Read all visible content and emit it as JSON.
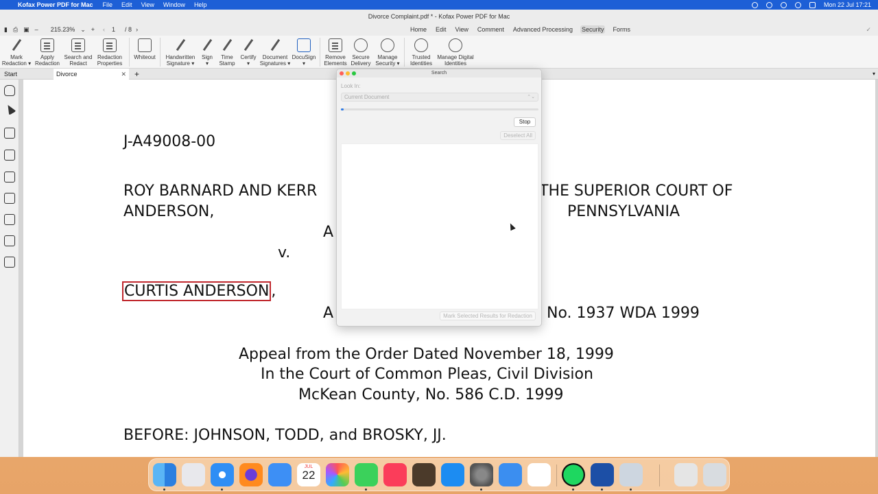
{
  "menubar": {
    "app_name": "Kofax Power PDF for Mac",
    "items": [
      "File",
      "Edit",
      "View",
      "Window",
      "Help"
    ],
    "datetime": "Mon 22 Jul  17:21"
  },
  "window": {
    "title": "Divorce Complaint.pdf * - Kofax Power PDF for Mac",
    "zoom": "215.23%",
    "page_current": "1",
    "page_total": "/ 8",
    "nav_tabs": [
      "Home",
      "Edit",
      "View",
      "Comment",
      "Advanced Processing",
      "Security",
      "Forms"
    ],
    "active_tab": "Security"
  },
  "ribbon": {
    "tools": [
      {
        "line1": "Mark",
        "line2": "Redaction ▾"
      },
      {
        "line1": "Apply",
        "line2": "Redaction"
      },
      {
        "line1": "Search and",
        "line2": "Redact"
      },
      {
        "line1": "Redaction",
        "line2": "Properties"
      },
      {
        "line1": "Whiteout",
        "line2": ""
      },
      {
        "line1": "Handwritten",
        "line2": "Signature ▾"
      },
      {
        "line1": "Sign",
        "line2": "▾"
      },
      {
        "line1": "Time",
        "line2": "Stamp"
      },
      {
        "line1": "Certify",
        "line2": "▾"
      },
      {
        "line1": "Document",
        "line2": "Signatures ▾"
      },
      {
        "line1": "DocuSign",
        "line2": "▾"
      },
      {
        "line1": "Remove",
        "line2": "Elements"
      },
      {
        "line1": "Secure",
        "line2": "Delivery"
      },
      {
        "line1": "Manage",
        "line2": "Security ▾"
      },
      {
        "line1": "Trusted",
        "line2": "Identities"
      },
      {
        "line1": "Manage Digital",
        "line2": "Identities"
      }
    ]
  },
  "tabs": {
    "start": "Start",
    "document": "Divorce Complaint.pdf *"
  },
  "document": {
    "case_id": "J-A49008-00",
    "plaintiff_line1": "ROY BARNARD AND KERR",
    "plaintiff_line2": "ANDERSON,",
    "court_line1": "THE SUPERIOR COURT OF",
    "court_line2": "PENNSYLVANIA",
    "fragment_a1": "A",
    "versus": "v.",
    "defendant": "CURTIS ANDERSON",
    "defendant_comma": ",",
    "fragment_a2": "A",
    "docket": "No. 1937 WDA 1999",
    "appeal_line1": "Appeal from the Order Dated November 18, 1999",
    "appeal_line2": "In the Court of Common Pleas, Civil Division",
    "appeal_line3": "McKean County, No. 586 C.D. 1999",
    "before": "BEFORE:  JOHNSON, TODD, and BROSKY, JJ."
  },
  "search_panel": {
    "title": "Search",
    "look_in_label": "Look In:",
    "look_in_value": "Current Document",
    "progress_fraction": 0.01,
    "stop_label": "Stop",
    "deselect_label": "Deselect All",
    "mark_label": "Mark Selected Results for Redaction"
  },
  "dock": {
    "calendar_month": "JUL",
    "calendar_day": "22"
  },
  "colors": {
    "accent": "#1d5fd6",
    "redaction": "#c0272d",
    "progress": "#2e7ae5"
  }
}
